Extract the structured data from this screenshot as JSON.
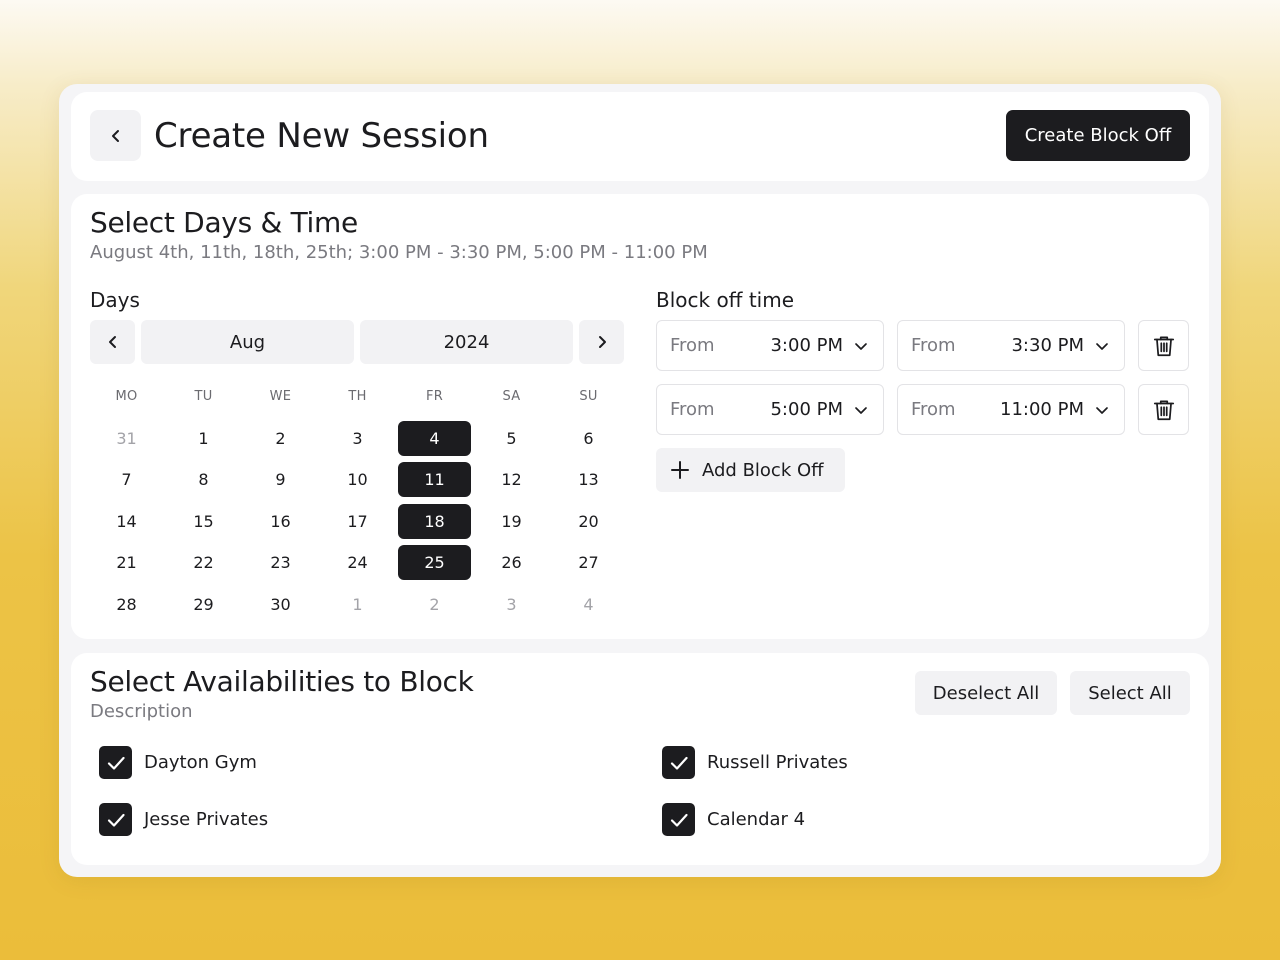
{
  "header": {
    "title": "Create New Session",
    "create_block_off_label": "Create Block Off"
  },
  "days_time": {
    "title": "Select Days & Time",
    "summary": "August 4th, 11th, 18th, 25th; 3:00 PM - 3:30 PM, 5:00 PM - 11:00 PM",
    "days_label": "Days",
    "calendar": {
      "month": "Aug",
      "year": "2024",
      "weekdays": [
        "MO",
        "TU",
        "WE",
        "TH",
        "FR",
        "SA",
        "SU"
      ],
      "days": [
        {
          "label": "31",
          "muted": true,
          "selected": false
        },
        {
          "label": "1",
          "muted": false,
          "selected": false
        },
        {
          "label": "2",
          "muted": false,
          "selected": false
        },
        {
          "label": "3",
          "muted": false,
          "selected": false
        },
        {
          "label": "4",
          "muted": false,
          "selected": true
        },
        {
          "label": "5",
          "muted": false,
          "selected": false
        },
        {
          "label": "6",
          "muted": false,
          "selected": false
        },
        {
          "label": "7",
          "muted": false,
          "selected": false
        },
        {
          "label": "8",
          "muted": false,
          "selected": false
        },
        {
          "label": "9",
          "muted": false,
          "selected": false
        },
        {
          "label": "10",
          "muted": false,
          "selected": false
        },
        {
          "label": "11",
          "muted": false,
          "selected": true
        },
        {
          "label": "12",
          "muted": false,
          "selected": false
        },
        {
          "label": "13",
          "muted": false,
          "selected": false
        },
        {
          "label": "14",
          "muted": false,
          "selected": false
        },
        {
          "label": "15",
          "muted": false,
          "selected": false
        },
        {
          "label": "16",
          "muted": false,
          "selected": false
        },
        {
          "label": "17",
          "muted": false,
          "selected": false
        },
        {
          "label": "18",
          "muted": false,
          "selected": true
        },
        {
          "label": "19",
          "muted": false,
          "selected": false
        },
        {
          "label": "20",
          "muted": false,
          "selected": false
        },
        {
          "label": "21",
          "muted": false,
          "selected": false
        },
        {
          "label": "22",
          "muted": false,
          "selected": false
        },
        {
          "label": "23",
          "muted": false,
          "selected": false
        },
        {
          "label": "24",
          "muted": false,
          "selected": false
        },
        {
          "label": "25",
          "muted": false,
          "selected": true
        },
        {
          "label": "26",
          "muted": false,
          "selected": false
        },
        {
          "label": "27",
          "muted": false,
          "selected": false
        },
        {
          "label": "28",
          "muted": false,
          "selected": false
        },
        {
          "label": "29",
          "muted": false,
          "selected": false
        },
        {
          "label": "30",
          "muted": false,
          "selected": false
        },
        {
          "label": "1",
          "muted": true,
          "selected": false
        },
        {
          "label": "2",
          "muted": true,
          "selected": false
        },
        {
          "label": "3",
          "muted": true,
          "selected": false
        },
        {
          "label": "4",
          "muted": true,
          "selected": false
        }
      ]
    },
    "block_off_label": "Block off time",
    "block_offs": [
      {
        "from_label_1": "From",
        "start": "3:00 PM",
        "from_label_2": "From",
        "end": "3:30 PM"
      },
      {
        "from_label_1": "From",
        "start": "5:00 PM",
        "from_label_2": "From",
        "end": "11:00 PM"
      }
    ],
    "add_block_off_label": "Add Block Off"
  },
  "availabilities": {
    "title": "Select Availabilities to Block",
    "description": "Description",
    "deselect_all_label": "Deselect All",
    "select_all_label": "Select All",
    "items": [
      {
        "label": "Dayton Gym",
        "checked": true
      },
      {
        "label": "Russell Privates",
        "checked": true
      },
      {
        "label": "Jesse Privates",
        "checked": true
      },
      {
        "label": "Calendar 4",
        "checked": true
      }
    ]
  }
}
